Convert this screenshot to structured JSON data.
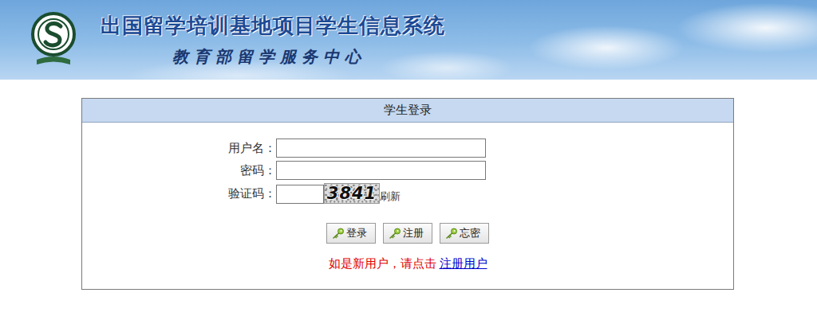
{
  "header": {
    "title": "出国留学培训基地项目学生信息系统",
    "subtitle": "教育部留学服务中心"
  },
  "login": {
    "title": "学生登录",
    "fields": [
      {
        "label": "用户名：",
        "value": ""
      },
      {
        "label": "密码：",
        "value": ""
      }
    ],
    "captcha": {
      "label": "验证码：",
      "value": "",
      "code": "3841",
      "refresh": "刷新"
    },
    "buttons": [
      "登录",
      "注册",
      "忘密"
    ],
    "hint": "如是新用户，请点击",
    "link": "注册用户"
  }
}
